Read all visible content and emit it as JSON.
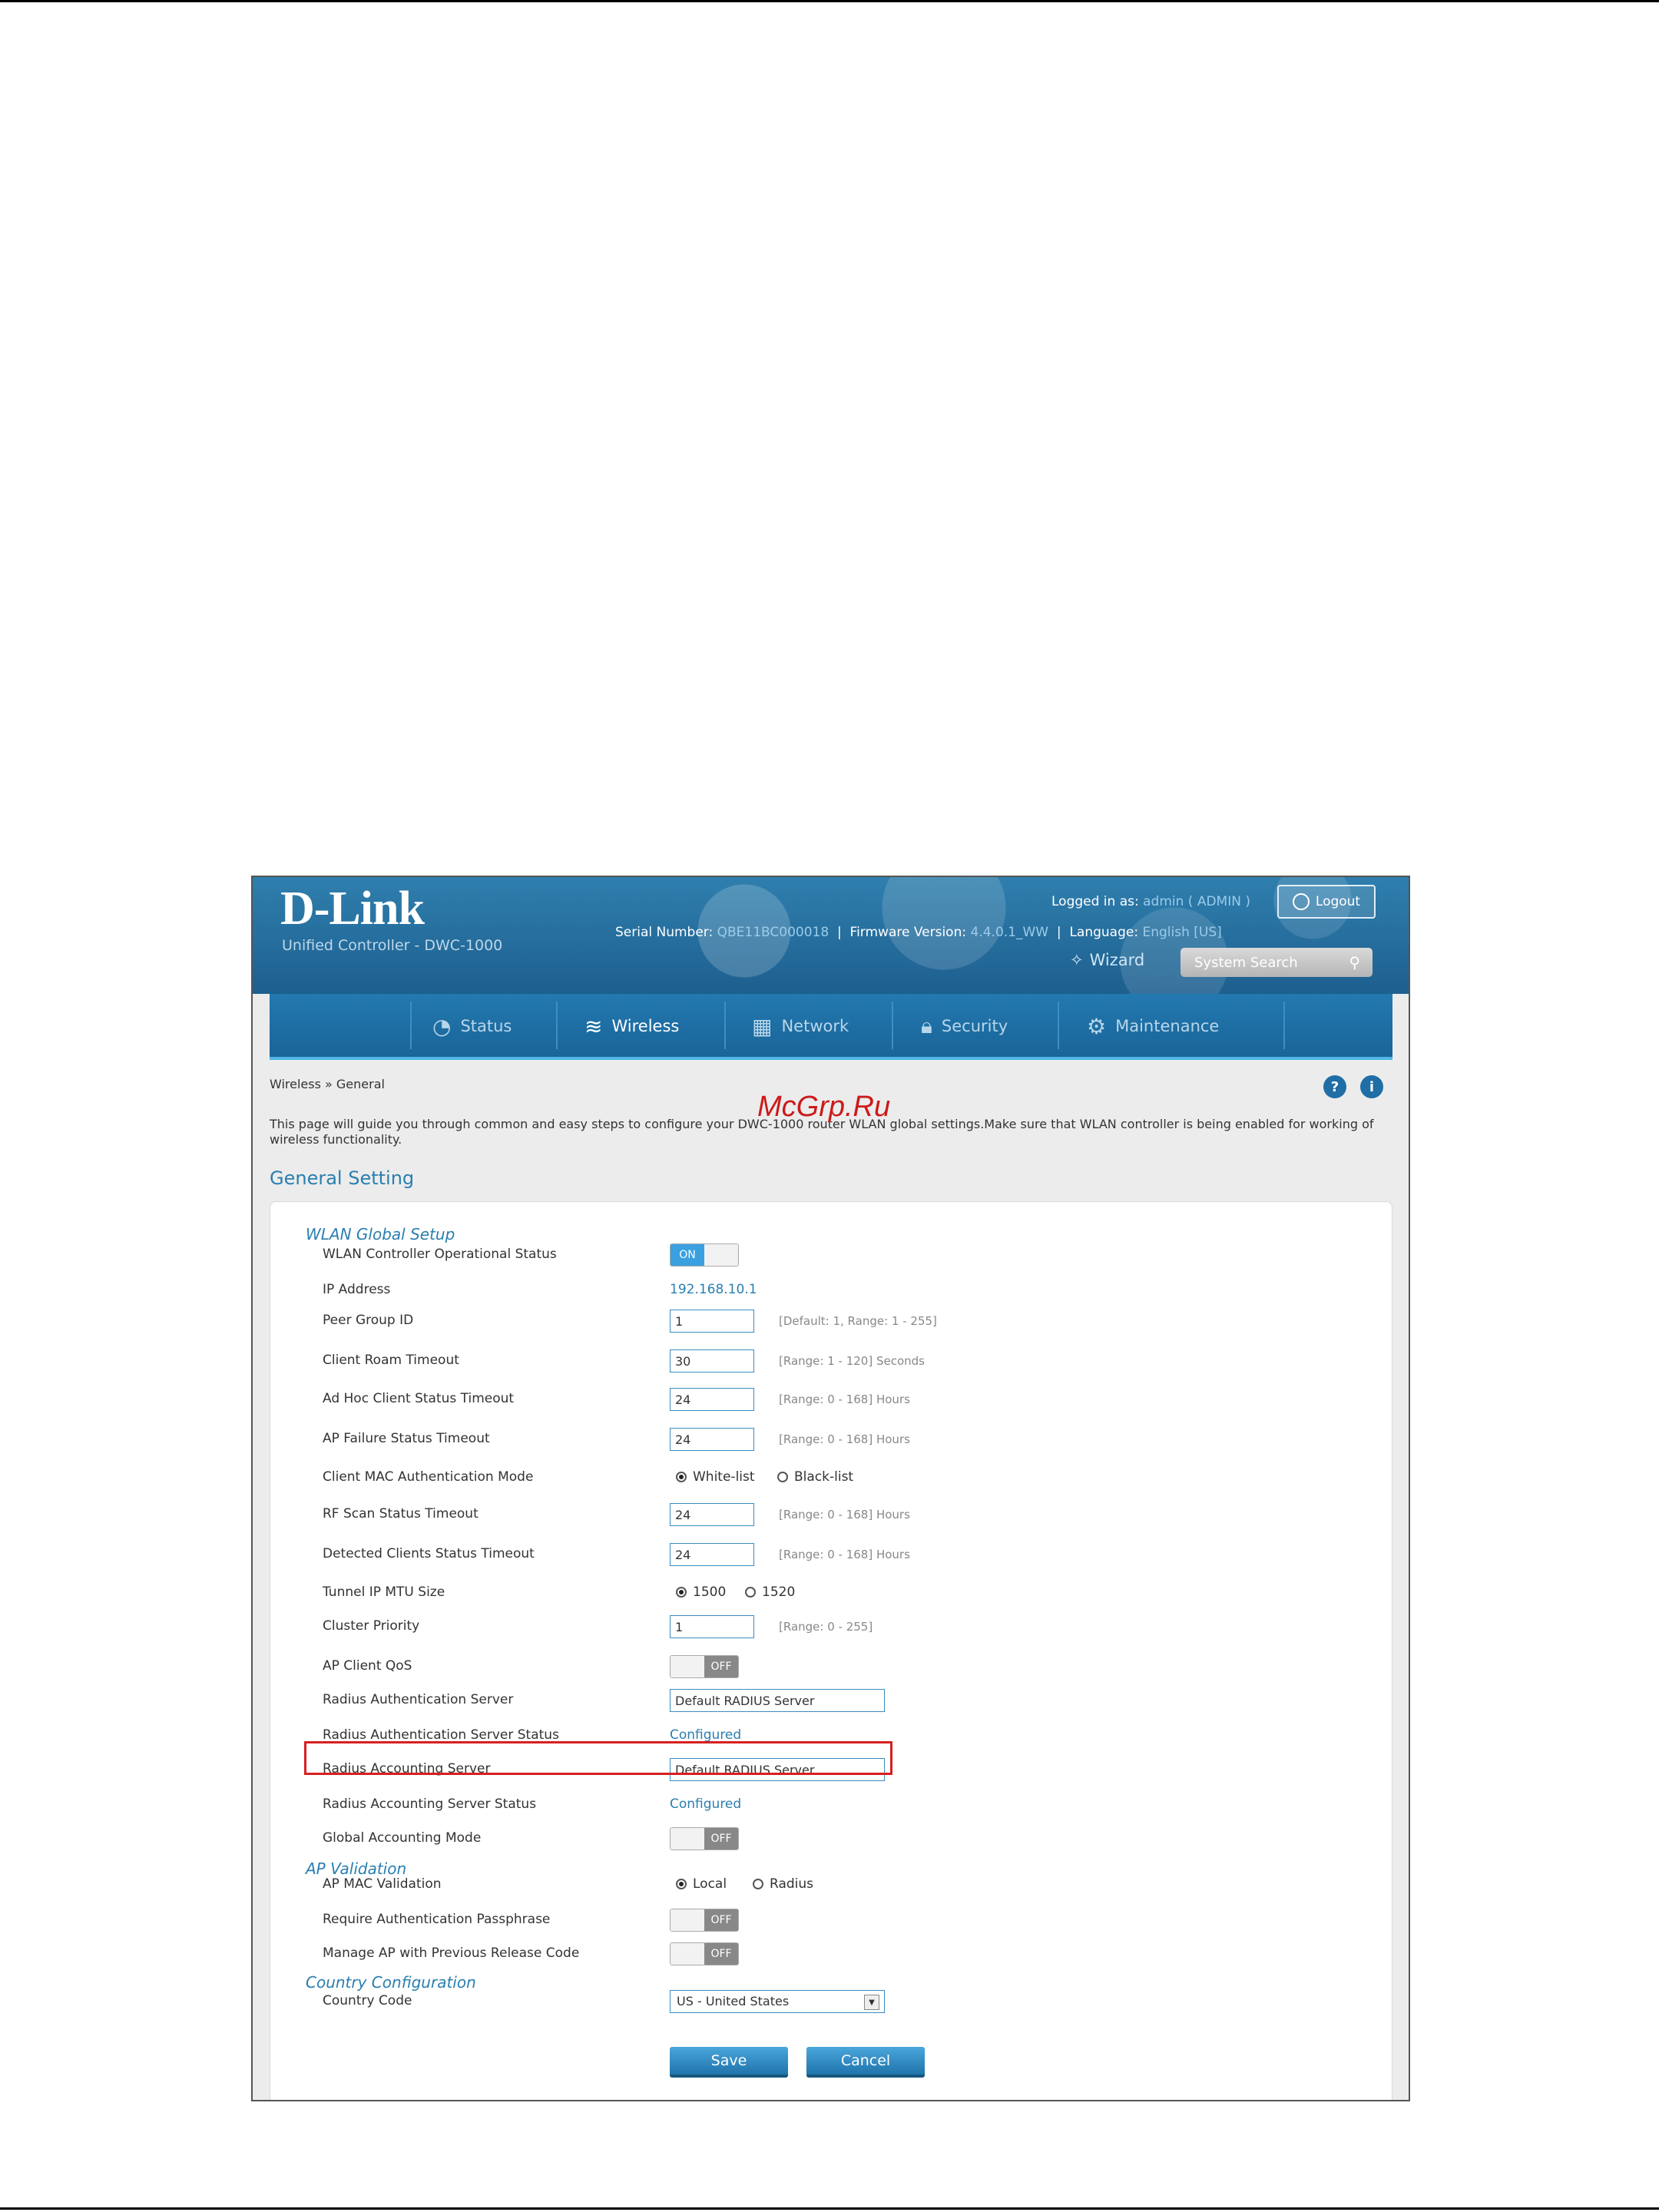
{
  "watermark": "McGrp.Ru",
  "header": {
    "brand": "D-Link",
    "product": "Unified Controller - DWC-1000",
    "serial_label": "Serial Number:",
    "serial_value": "QBE11BC000018",
    "firmware_label": "Firmware Version:",
    "firmware_value": "4.4.0.1_WW",
    "logged_label": "Logged in as:",
    "logged_value": "admin ( ADMIN )",
    "language_label": "Language:",
    "language_value": "English [US]",
    "logout": "Logout",
    "wizard": "Wizard",
    "search_placeholder": "System Search"
  },
  "nav": [
    {
      "label": "Status",
      "icon": "gauge-icon",
      "glyph": "◔"
    },
    {
      "label": "Wireless",
      "icon": "wifi-icon",
      "glyph": "≋"
    },
    {
      "label": "Network",
      "icon": "network-icon",
      "glyph": "▦"
    },
    {
      "label": "Security",
      "icon": "lock-icon",
      "glyph": "🔒︎"
    },
    {
      "label": "Maintenance",
      "icon": "gear-icon",
      "glyph": "⚙"
    }
  ],
  "breadcrumb": "Wireless » General",
  "description": "This page will guide you through common and easy steps to configure your DWC-1000 router WLAN global settings.Make sure that WLAN controller is being enabled for working of wireless functionality.",
  "section_title": "General Setting",
  "groups": {
    "wlan": "WLAN Global Setup",
    "ap": "AP Validation",
    "country": "Country Configuration"
  },
  "fields": {
    "op_status": {
      "label": "WLAN Controller Operational Status",
      "on": "ON"
    },
    "ip": {
      "label": "IP Address",
      "value": "192.168.10.1"
    },
    "peer": {
      "label": "Peer Group ID",
      "value": "1",
      "hint": "[Default: 1, Range: 1 - 255]"
    },
    "roam": {
      "label": "Client Roam Timeout",
      "value": "30",
      "hint": "[Range: 1 - 120] Seconds"
    },
    "adhoc": {
      "label": "Ad Hoc Client Status Timeout",
      "value": "24",
      "hint": "[Range: 0 - 168] Hours"
    },
    "apfail": {
      "label": "AP Failure Status Timeout",
      "value": "24",
      "hint": "[Range: 0 - 168] Hours"
    },
    "macauth": {
      "label": "Client MAC Authentication Mode",
      "opt1": "White-list",
      "opt2": "Black-list"
    },
    "rfscan": {
      "label": "RF Scan Status Timeout",
      "value": "24",
      "hint": "[Range: 0 - 168] Hours"
    },
    "detected": {
      "label": "Detected Clients Status Timeout",
      "value": "24",
      "hint": "[Range: 0 - 168] Hours"
    },
    "mtu": {
      "label": "Tunnel IP MTU Size",
      "opt1": "1500",
      "opt2": "1520"
    },
    "cluster": {
      "label": "Cluster Priority",
      "value": "1",
      "hint": "[Range: 0 - 255]"
    },
    "qos": {
      "label": "AP Client QoS",
      "off": "OFF"
    },
    "radauth": {
      "label": "Radius Authentication Server",
      "value": "Default RADIUS Server"
    },
    "radauth_status": {
      "label": "Radius Authentication Server Status",
      "value": "Configured"
    },
    "radacct": {
      "label": "Radius Accounting Server",
      "value": "Default RADIUS Server"
    },
    "radacct_status": {
      "label": "Radius Accounting Server Status",
      "value": "Configured"
    },
    "globalacct": {
      "label": "Global Accounting Mode",
      "off": "OFF"
    },
    "apmac": {
      "label": "AP MAC Validation",
      "opt1": "Local",
      "opt2": "Radius"
    },
    "passphrase": {
      "label": "Require Authentication Passphrase",
      "off": "OFF"
    },
    "manage": {
      "label": "Manage AP with Previous Release Code",
      "off": "OFF"
    },
    "country": {
      "label": "Country Code",
      "value": "US - United States"
    }
  },
  "buttons": {
    "save": "Save",
    "cancel": "Cancel"
  }
}
